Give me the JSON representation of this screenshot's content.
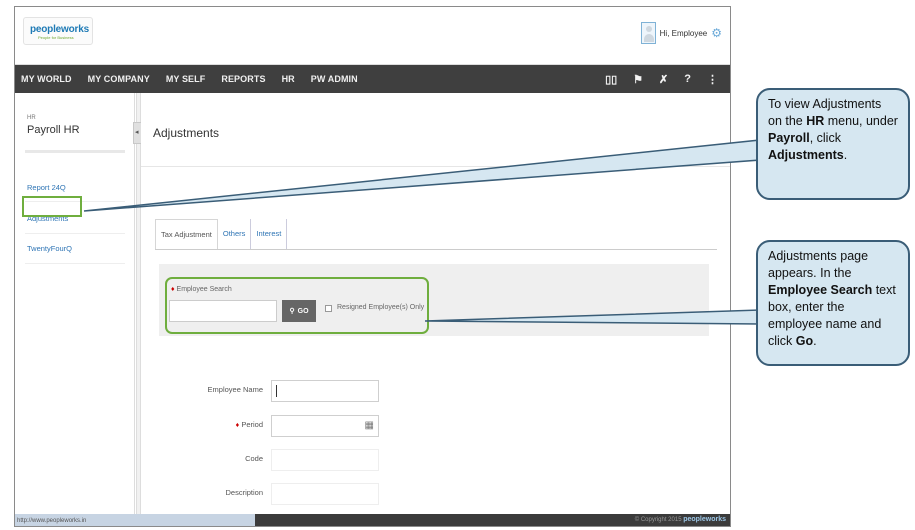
{
  "header": {
    "logo_text": "peopleworks",
    "logo_tagline": "People for Business",
    "greeting": "Hi, Employee"
  },
  "nav": {
    "items": [
      "MY WORLD",
      "MY COMPANY",
      "MY SELF",
      "REPORTS",
      "HR",
      "PW ADMIN"
    ]
  },
  "sidebar": {
    "section": "HR",
    "title": "Payroll HR",
    "items": [
      "Report 24Q",
      "Adjustments",
      "TwentyFourQ"
    ]
  },
  "main": {
    "title": "Adjustments",
    "tabs": [
      "Tax Adjustment",
      "Others",
      "Interest"
    ],
    "search": {
      "label": "Employee Search",
      "go_label": "GO",
      "checkbox_label": "Resigned Employee(s) Only"
    },
    "fields": [
      "Employee Name",
      "Period",
      "Code",
      "Description"
    ]
  },
  "statusbar": {
    "url": "http://www.peopleworks.in",
    "copyright": "© Copyright 2015",
    "brand": "peopleworks"
  },
  "callouts": {
    "one": {
      "p1": "To view Adjustments on the ",
      "b1": "HR",
      "p2": " menu, under ",
      "b2": "Payroll",
      "p3": ", click ",
      "b3": "Adjustments",
      "p4": "."
    },
    "two": {
      "p1": "Adjustments page appears. In the ",
      "b1": "Employee Search",
      "p2": " text box, enter the employee name and click ",
      "b2": "Go",
      "p3": "."
    }
  },
  "colors": {
    "nav_bg": "#3f3f3f",
    "highlight_green": "#6fae3e",
    "link_blue": "#2f75b5",
    "callout_bg": "#d6e7f1",
    "callout_border": "#3a5d77"
  }
}
